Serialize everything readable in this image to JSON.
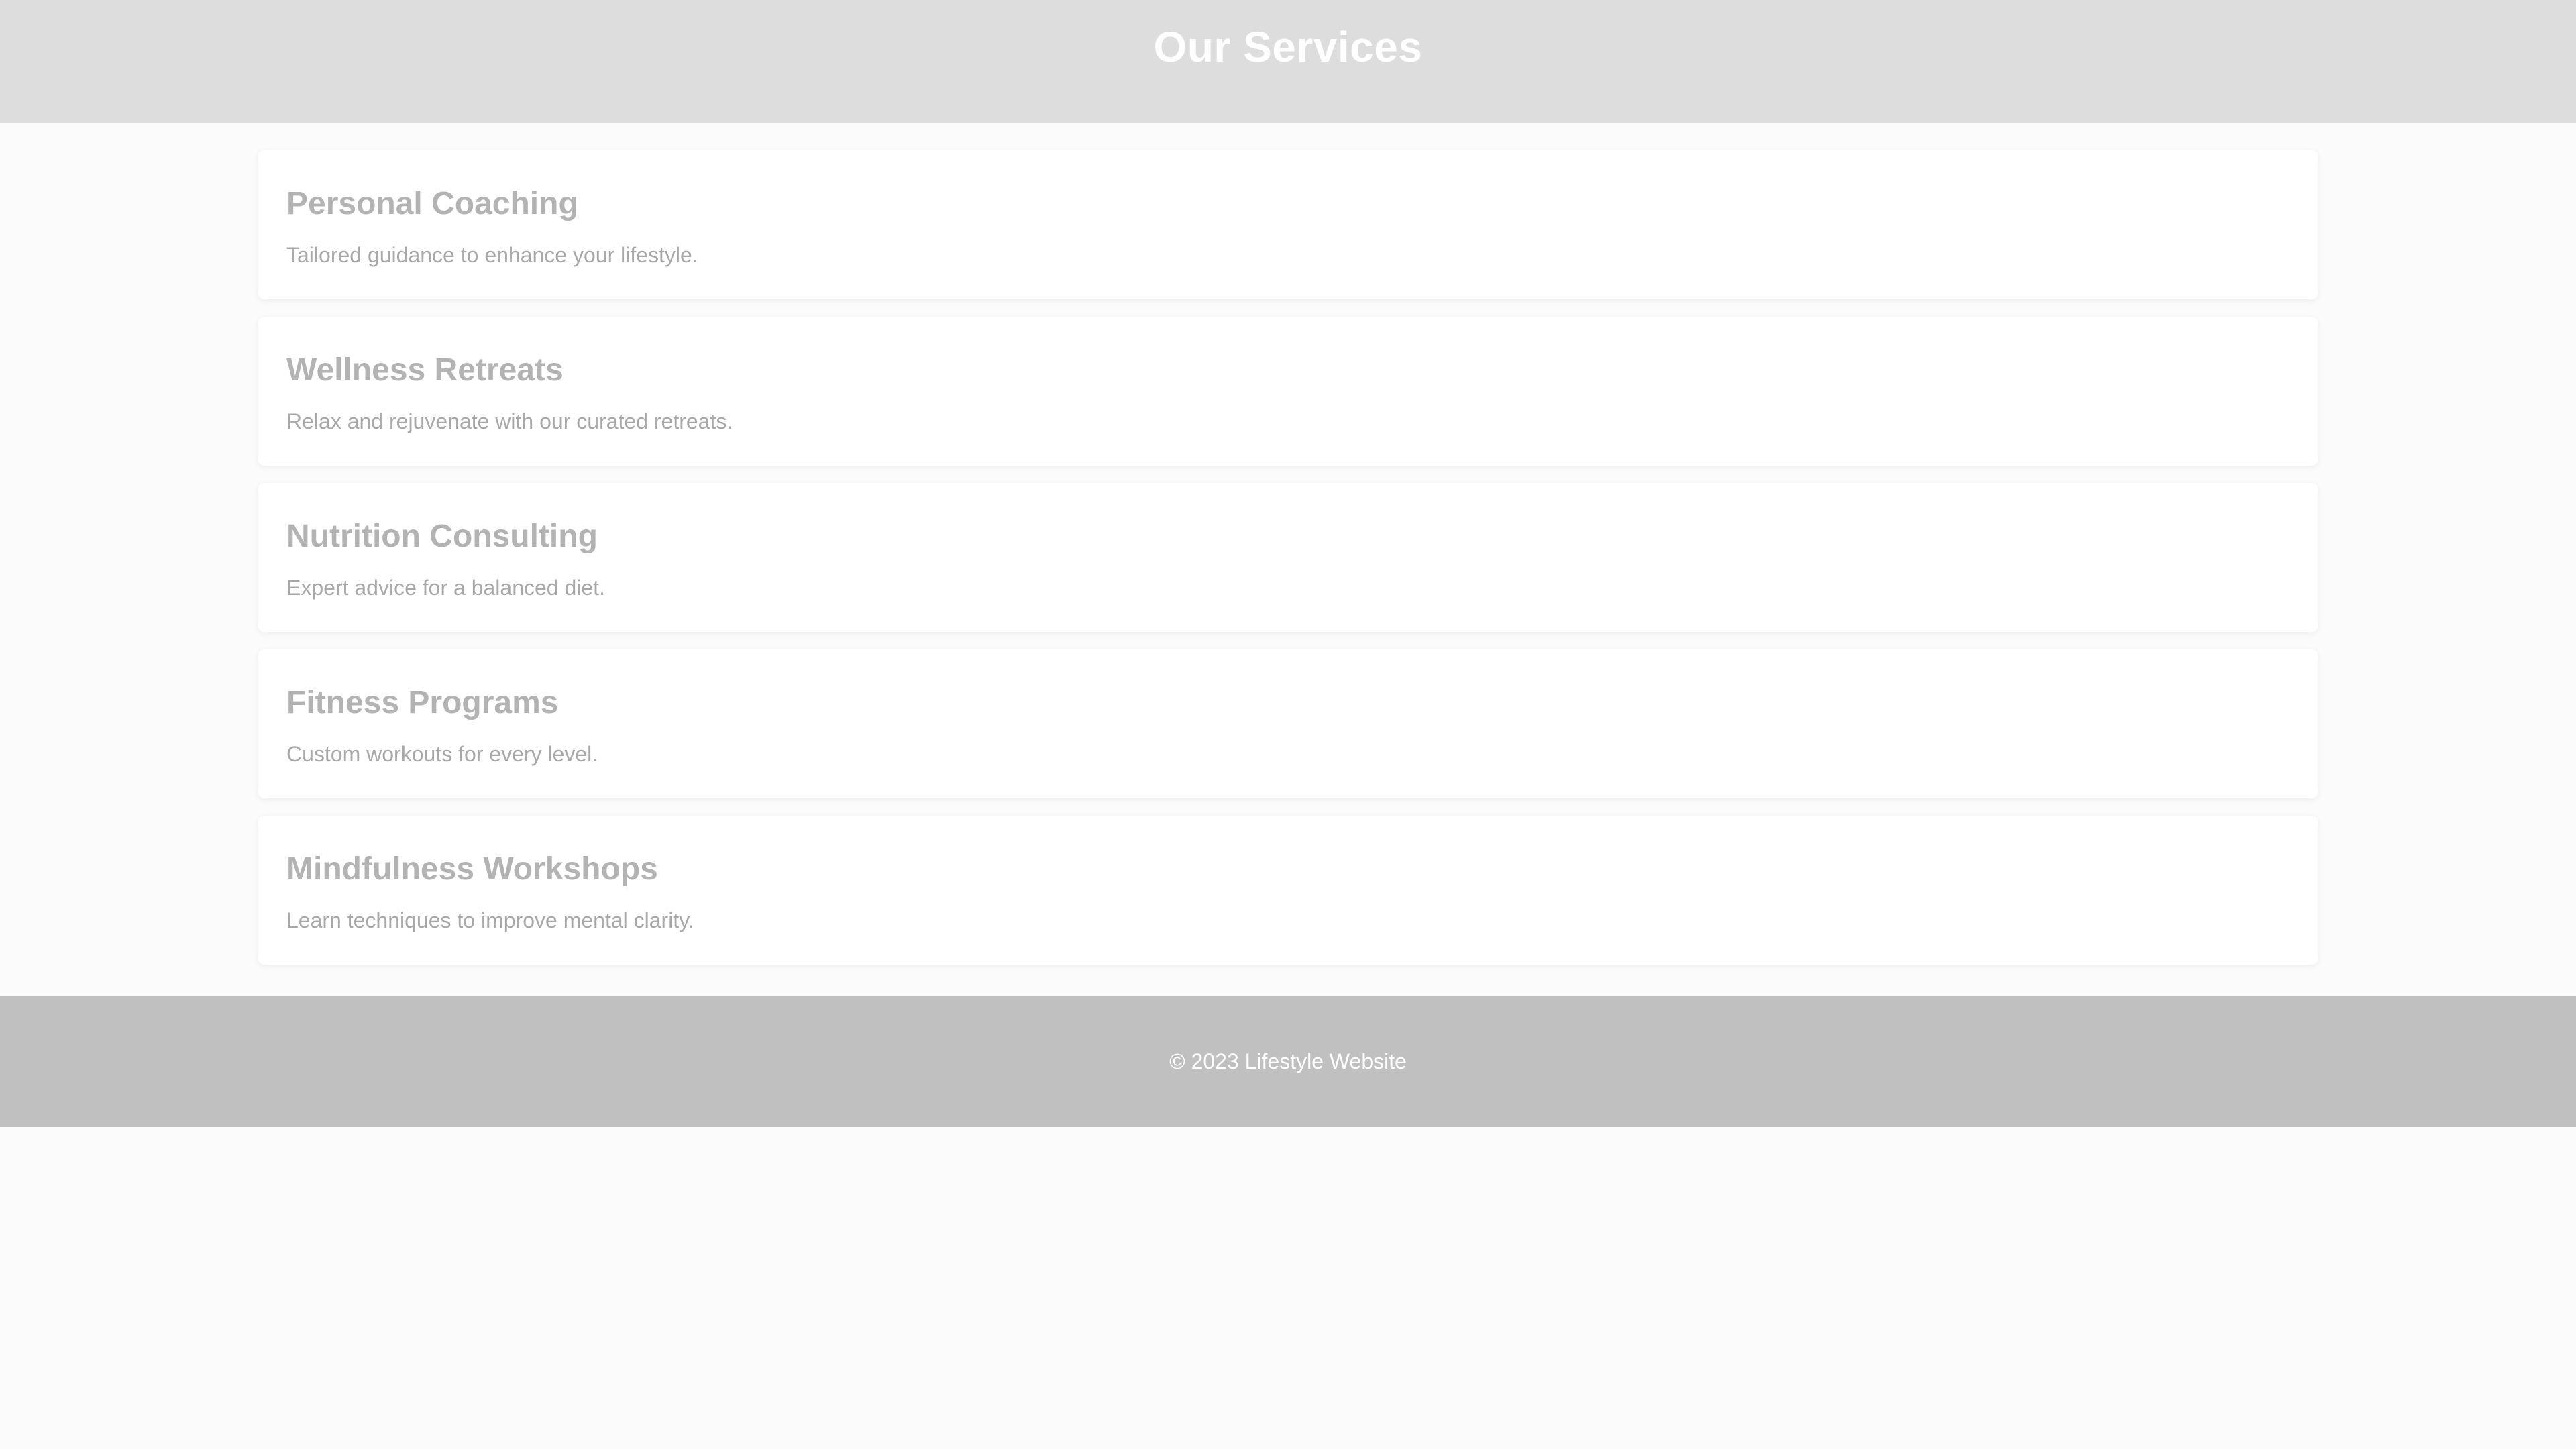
{
  "header": {
    "title": "Our Services"
  },
  "services": [
    {
      "title": "Personal Coaching",
      "description": "Tailored guidance to enhance your lifestyle."
    },
    {
      "title": "Wellness Retreats",
      "description": "Relax and rejuvenate with our curated retreats."
    },
    {
      "title": "Nutrition Consulting",
      "description": "Expert advice for a balanced diet."
    },
    {
      "title": "Fitness Programs",
      "description": "Custom workouts for every level."
    },
    {
      "title": "Mindfulness Workshops",
      "description": "Learn techniques to improve mental clarity."
    }
  ],
  "footer": {
    "text": "© 2023 Lifestyle Website"
  },
  "colors": {
    "header_bg": "#dddddd",
    "footer_bg": "#c0c0c0",
    "page_bg": "#fbfbfb",
    "card_title": "#b3b3b3",
    "card_text": "#a8a8a8"
  }
}
